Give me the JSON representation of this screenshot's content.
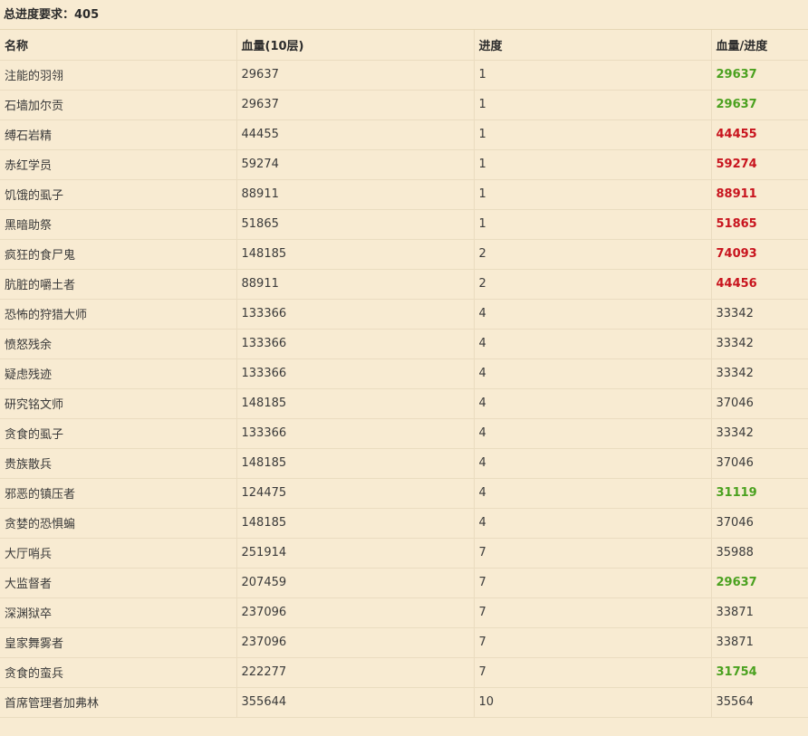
{
  "summary": {
    "label": "总进度要求：405"
  },
  "table": {
    "headers": [
      "名称",
      "血量(10层)",
      "进度",
      "血量/进度"
    ],
    "rows": [
      {
        "name": "注能的羽翎",
        "hp": "29637",
        "progress": "1",
        "ratio": "29637",
        "status": "good"
      },
      {
        "name": "石墙加尔贡",
        "hp": "29637",
        "progress": "1",
        "ratio": "29637",
        "status": "good"
      },
      {
        "name": "缚石岩精",
        "hp": "44455",
        "progress": "1",
        "ratio": "44455",
        "status": "bad"
      },
      {
        "name": "赤红学员",
        "hp": "59274",
        "progress": "1",
        "ratio": "59274",
        "status": "bad"
      },
      {
        "name": "饥饿的虱子",
        "hp": "88911",
        "progress": "1",
        "ratio": "88911",
        "status": "bad"
      },
      {
        "name": "黑暗助祭",
        "hp": "51865",
        "progress": "1",
        "ratio": "51865",
        "status": "bad"
      },
      {
        "name": "疯狂的食尸鬼",
        "hp": "148185",
        "progress": "2",
        "ratio": "74093",
        "status": "bad"
      },
      {
        "name": "肮脏的嚼土者",
        "hp": "88911",
        "progress": "2",
        "ratio": "44456",
        "status": "bad"
      },
      {
        "name": "恐怖的狩猎大师",
        "hp": "133366",
        "progress": "4",
        "ratio": "33342",
        "status": "normal"
      },
      {
        "name": "愤怒残余",
        "hp": "133366",
        "progress": "4",
        "ratio": "33342",
        "status": "normal"
      },
      {
        "name": "疑虑残迹",
        "hp": "133366",
        "progress": "4",
        "ratio": "33342",
        "status": "normal"
      },
      {
        "name": "研究铭文师",
        "hp": "148185",
        "progress": "4",
        "ratio": "37046",
        "status": "normal"
      },
      {
        "name": "贪食的虱子",
        "hp": "133366",
        "progress": "4",
        "ratio": "33342",
        "status": "normal"
      },
      {
        "name": "贵族散兵",
        "hp": "148185",
        "progress": "4",
        "ratio": "37046",
        "status": "normal"
      },
      {
        "name": "邪恶的镇压者",
        "hp": "124475",
        "progress": "4",
        "ratio": "31119",
        "status": "good"
      },
      {
        "name": "贪婪的恐惧蝙",
        "hp": "148185",
        "progress": "4",
        "ratio": "37046",
        "status": "normal"
      },
      {
        "name": "大厅哨兵",
        "hp": "251914",
        "progress": "7",
        "ratio": "35988",
        "status": "normal"
      },
      {
        "name": "大监督者",
        "hp": "207459",
        "progress": "7",
        "ratio": "29637",
        "status": "good"
      },
      {
        "name": "深渊狱卒",
        "hp": "237096",
        "progress": "7",
        "ratio": "33871",
        "status": "normal"
      },
      {
        "name": "皇家舞雾者",
        "hp": "237096",
        "progress": "7",
        "ratio": "33871",
        "status": "normal"
      },
      {
        "name": "贪食的蛮兵",
        "hp": "222277",
        "progress": "7",
        "ratio": "31754",
        "status": "good"
      },
      {
        "name": "首席管理者加弗林",
        "hp": "355644",
        "progress": "10",
        "ratio": "35564",
        "status": "normal"
      }
    ]
  },
  "colors": {
    "good": "#4aa11f",
    "bad": "#c8141e",
    "background": "#f8ebd2"
  }
}
